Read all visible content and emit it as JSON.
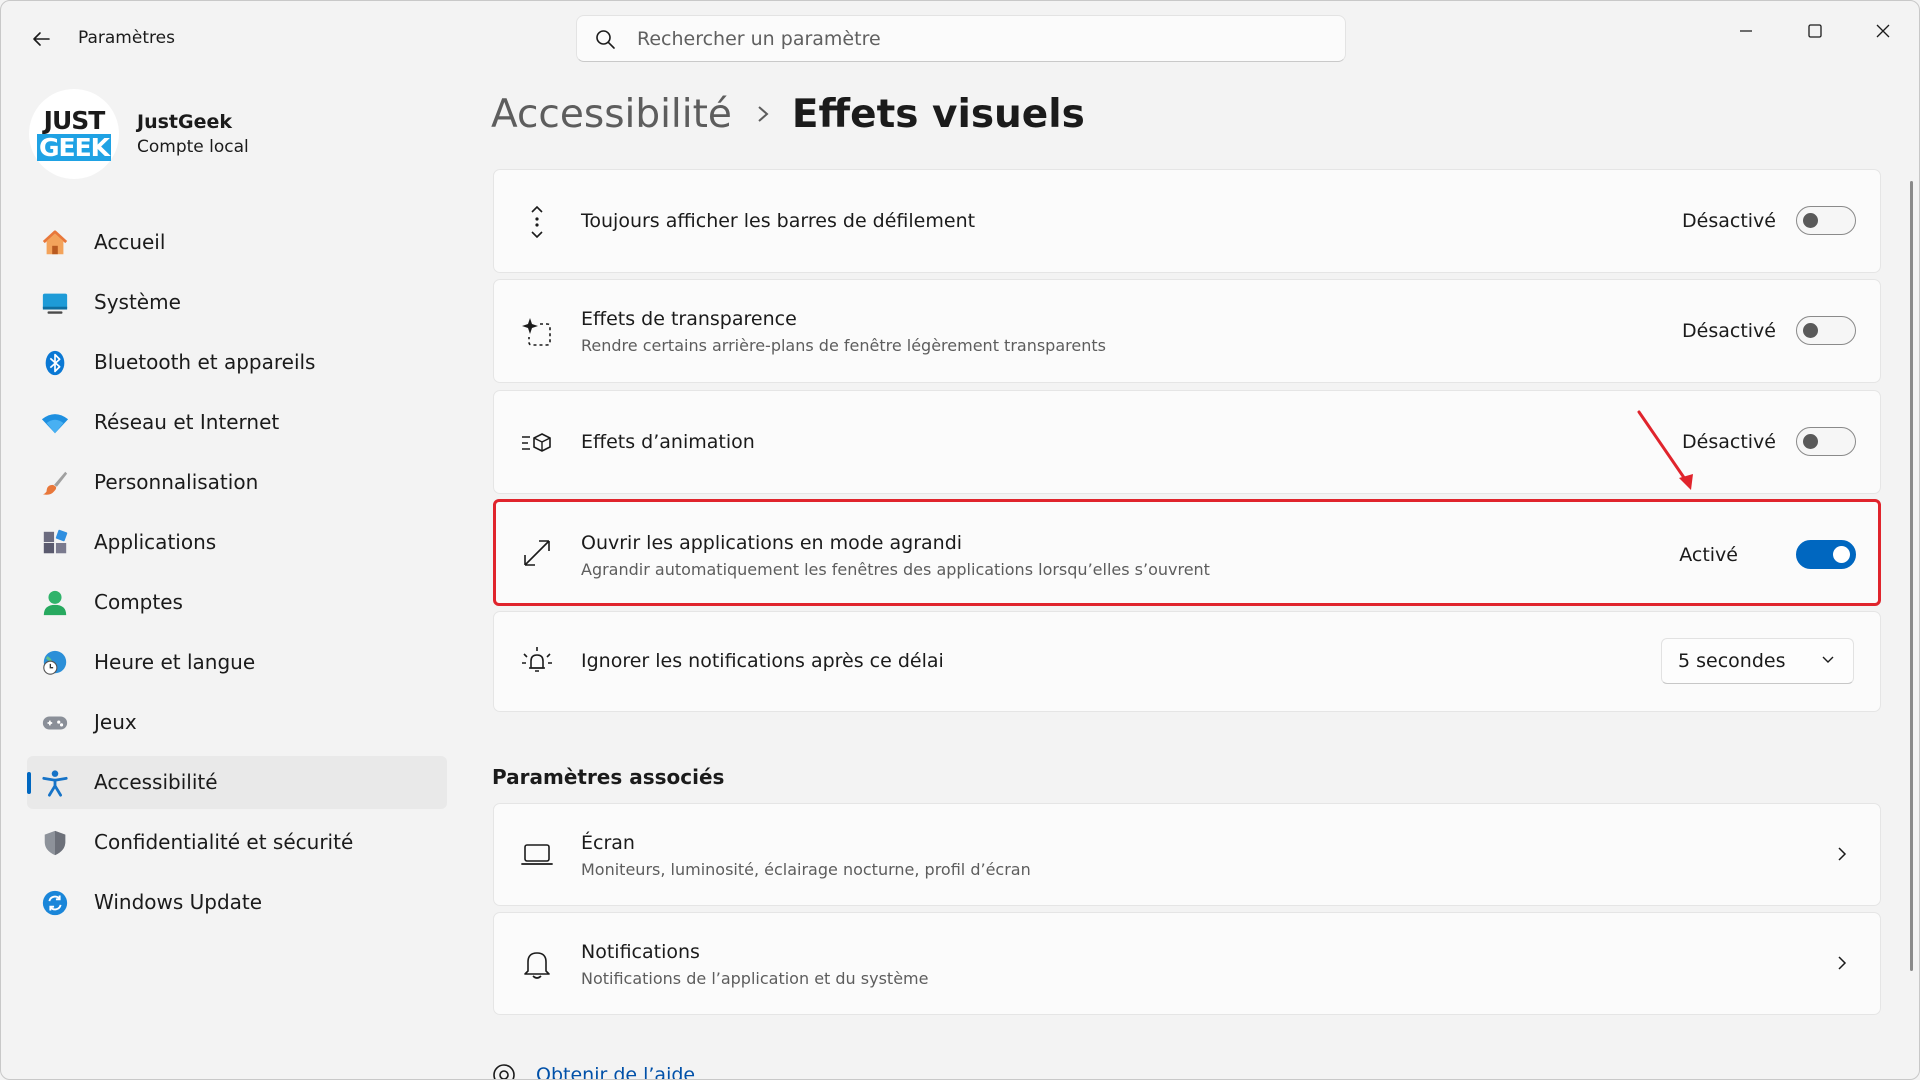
{
  "window": {
    "title": "Paramètres"
  },
  "search": {
    "placeholder": "Rechercher un paramètre"
  },
  "profile": {
    "logo_top": "JUST",
    "logo_bottom": "GEEK",
    "name": "JustGeek",
    "account": "Compte local"
  },
  "sidebar": {
    "items": [
      {
        "label": "Accueil",
        "icon": "home-icon"
      },
      {
        "label": "Système",
        "icon": "system-icon"
      },
      {
        "label": "Bluetooth et appareils",
        "icon": "bluetooth-icon"
      },
      {
        "label": "Réseau et Internet",
        "icon": "wifi-icon"
      },
      {
        "label": "Personnalisation",
        "icon": "brush-icon"
      },
      {
        "label": "Applications",
        "icon": "apps-icon"
      },
      {
        "label": "Comptes",
        "icon": "person-icon"
      },
      {
        "label": "Heure et langue",
        "icon": "globe-clock-icon"
      },
      {
        "label": "Jeux",
        "icon": "gamepad-icon"
      },
      {
        "label": "Accessibilité",
        "icon": "accessibility-icon",
        "active": true
      },
      {
        "label": "Confidentialité et sécurité",
        "icon": "shield-icon"
      },
      {
        "label": "Windows Update",
        "icon": "update-icon"
      }
    ]
  },
  "breadcrumb": {
    "parent": "Accessibilité",
    "current": "Effets visuels"
  },
  "settings": [
    {
      "title": "Toujours afficher les barres de défilement",
      "subtitle": "",
      "state_label": "Désactivé",
      "on": false,
      "icon": "scroll-arrows-icon"
    },
    {
      "title": "Effets de transparence",
      "subtitle": "Rendre certains arrière-plans de fenêtre légèrement transparents",
      "state_label": "Désactivé",
      "on": false,
      "icon": "transparency-icon"
    },
    {
      "title": "Effets d’animation",
      "subtitle": "",
      "state_label": "Désactivé",
      "on": false,
      "icon": "animation-icon"
    },
    {
      "title": "Ouvrir les applications en mode agrandi",
      "subtitle": "Agrandir automatiquement les fenêtres des applications lorsqu’elles s’ouvrent",
      "state_label": "Activé",
      "on": true,
      "icon": "expand-icon"
    },
    {
      "title": "Ignorer les notifications après ce délai",
      "subtitle": "",
      "dropdown_value": "5 secondes",
      "icon": "notification-sun-icon"
    }
  ],
  "related": {
    "title": "Paramètres associés",
    "items": [
      {
        "title": "Écran",
        "subtitle": "Moniteurs, luminosité, éclairage nocturne, profil d’écran",
        "icon": "laptop-icon"
      },
      {
        "title": "Notifications",
        "subtitle": "Notifications de l’application et du système",
        "icon": "bell-icon"
      }
    ]
  },
  "help": {
    "label": "Obtenir de l’aide"
  },
  "colors": {
    "accent": "#0067c0",
    "highlight": "#e0242c",
    "background": "#f3f3f3",
    "card": "#fbfbfb"
  }
}
